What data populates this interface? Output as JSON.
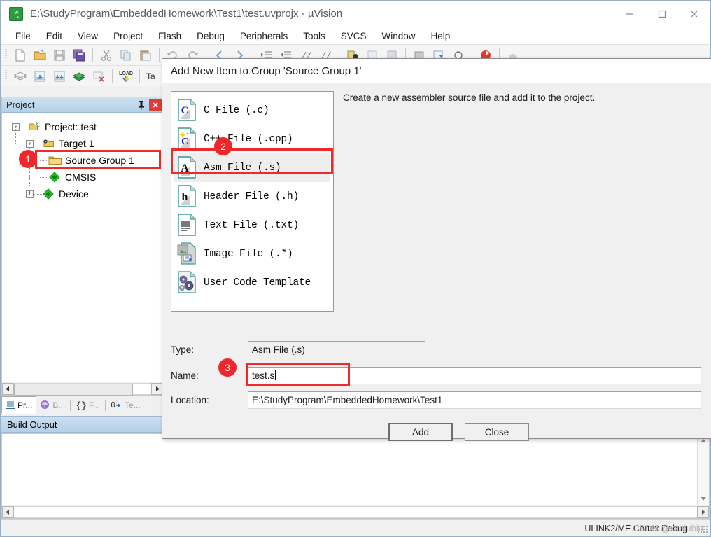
{
  "window": {
    "title": "E:\\StudyProgram\\EmbeddedHomework\\Test1\\test.uvprojx - µVision",
    "app_icon": "uvision-logo-icon",
    "controls": {
      "minimize": "minimize-icon",
      "maximize": "maximize-icon",
      "close": "close-icon"
    }
  },
  "menu": {
    "items": [
      {
        "label": "File"
      },
      {
        "label": "Edit"
      },
      {
        "label": "View"
      },
      {
        "label": "Project"
      },
      {
        "label": "Flash"
      },
      {
        "label": "Debug"
      },
      {
        "label": "Peripherals"
      },
      {
        "label": "Tools"
      },
      {
        "label": "SVCS"
      },
      {
        "label": "Window"
      },
      {
        "label": "Help"
      }
    ]
  },
  "toolbar_row1": {
    "icons": [
      "new-file-icon",
      "open-folder-icon",
      "save-icon",
      "save-all-icon",
      "cut-icon",
      "copy-icon",
      "paste-icon",
      "undo-icon",
      "redo-icon",
      "navigate-back-icon",
      "navigate-forward-icon",
      "indent-icon",
      "outdent-icon",
      "comment-icon",
      "uncomment-icon",
      "bookmark-icon",
      "insert-bookmark-icon",
      "clear-bookmarks-icon",
      "build-icon",
      "rebuild-icon",
      "debug-icon",
      "reset-icon"
    ]
  },
  "toolbar_row2": {
    "icons": [
      "batch-build-icon",
      "translate-icon",
      "build-target-icon",
      "rebuild-all-icon",
      "stop-build-icon",
      "download-load-icon"
    ],
    "target_label": "Ta"
  },
  "project_panel": {
    "title": "Project",
    "pin_icon": "pin-icon",
    "close_icon": "panel-close-icon",
    "tree": [
      {
        "label": "Project: test",
        "icon": "project-icon",
        "indent": 0,
        "expander": "-"
      },
      {
        "label": "Target 1",
        "icon": "target-icon",
        "indent": 1,
        "expander": "-"
      },
      {
        "label": "Source Group 1",
        "icon": "folder-icon",
        "indent": 2,
        "expander": ""
      },
      {
        "label": "CMSIS",
        "icon": "component-icon",
        "indent": 2,
        "expander": ""
      },
      {
        "label": "Device",
        "icon": "component-icon",
        "indent": 2,
        "expander": "+"
      }
    ],
    "tabs": [
      {
        "label": "Pr...",
        "icon": "project-tab-icon",
        "active": true
      },
      {
        "label": "B...",
        "icon": "books-tab-icon",
        "active": false
      },
      {
        "label": "F...",
        "icon": "functions-tab-icon",
        "active": false
      },
      {
        "label": "Te...",
        "icon": "templates-tab-icon",
        "active": false
      }
    ]
  },
  "build_output": {
    "title": "Build Output",
    "content": ""
  },
  "status_bar": {
    "debugger": "ULINK2/ME Cortex Debug"
  },
  "watermark": {
    "text": "CSDN @xxbiubiu"
  },
  "dialog": {
    "title": "Add New Item to Group 'Source Group 1'",
    "description": "Create a new assembler source file and add it to the project.",
    "file_types": [
      {
        "label": "C File (.c)",
        "icon": "c-file-icon",
        "selected": false
      },
      {
        "label": "C++ File (.cpp)",
        "icon": "cpp-file-icon",
        "selected": false
      },
      {
        "label": "Asm File (.s)",
        "icon": "asm-file-icon",
        "selected": true
      },
      {
        "label": "Header File (.h)",
        "icon": "header-file-icon",
        "selected": false
      },
      {
        "label": "Text File (.txt)",
        "icon": "text-file-icon",
        "selected": false
      },
      {
        "label": "Image File (.*)",
        "icon": "image-file-icon",
        "selected": false
      },
      {
        "label": "User Code Template",
        "icon": "user-template-icon",
        "selected": false
      }
    ],
    "fields": {
      "type_label": "Type:",
      "type_value": "Asm File (.s)",
      "name_label": "Name:",
      "name_value": "test.s",
      "location_label": "Location:",
      "location_value": "E:\\StudyProgram\\EmbeddedHomework\\Test1"
    },
    "buttons": {
      "add": "Add",
      "close": "Close"
    }
  },
  "annotations": {
    "badges": [
      {
        "number": "1",
        "target": "source-group-1-tree-row"
      },
      {
        "number": "2",
        "target": "asm-file-list-item"
      },
      {
        "number": "3",
        "target": "name-input-field"
      }
    ],
    "highlight_color": "#f0262b"
  }
}
